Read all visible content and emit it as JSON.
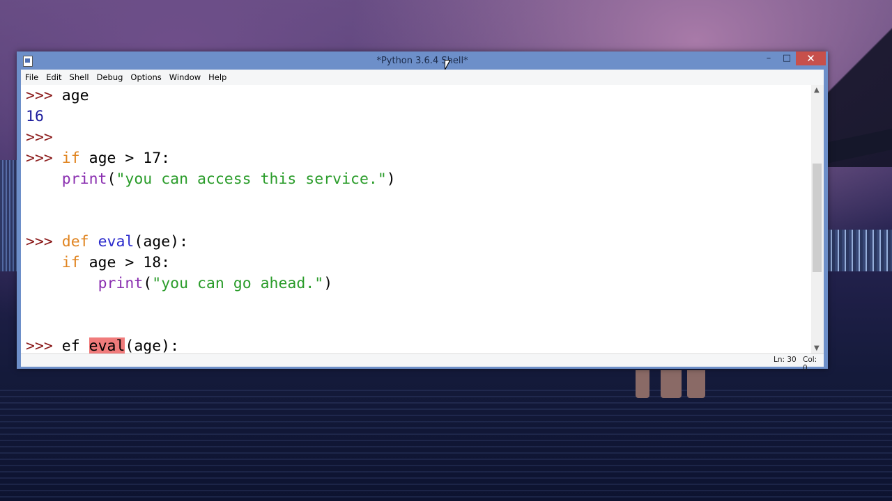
{
  "window": {
    "title": "*Python 3.6.4 Shell*",
    "minimize": "–",
    "maximize": "□",
    "close": "✕"
  },
  "menu": [
    "File",
    "Edit",
    "Shell",
    "Debug",
    "Options",
    "Window",
    "Help"
  ],
  "code": {
    "prompt": ">>>",
    "l1_text": " age",
    "l2_out": "16",
    "l4_kw": "if",
    "l4_text": " age > 17:",
    "l5_indent": "    ",
    "l5_fn": "print",
    "l5_open": "(",
    "l5_str": "\"you can access this service.\"",
    "l5_close": ")",
    "l7_kw": "def",
    "l7_def": "eval",
    "l7_text": "(age):",
    "l8_indent": "    ",
    "l8_kw": "if",
    "l8_text": " age > 18:",
    "l9_indent": "        ",
    "l9_fn": "print",
    "l9_open": "(",
    "l9_str": "\"you can go ahead.\"",
    "l9_close": ")",
    "l11_text": " ef ",
    "l11_err": "eval",
    "l11_rest": "(age):"
  },
  "status": {
    "ln": "Ln: 30",
    "col": "Col: 0"
  },
  "colors": {
    "prompt": "#8b1a1a",
    "keyword": "#e08420",
    "builtin": "#8a2fb0",
    "string": "#2a9c2a",
    "definition": "#2a2acc",
    "output": "#1a1a9c",
    "error_highlight": "#f07b7b",
    "close_button": "#c7504b"
  }
}
